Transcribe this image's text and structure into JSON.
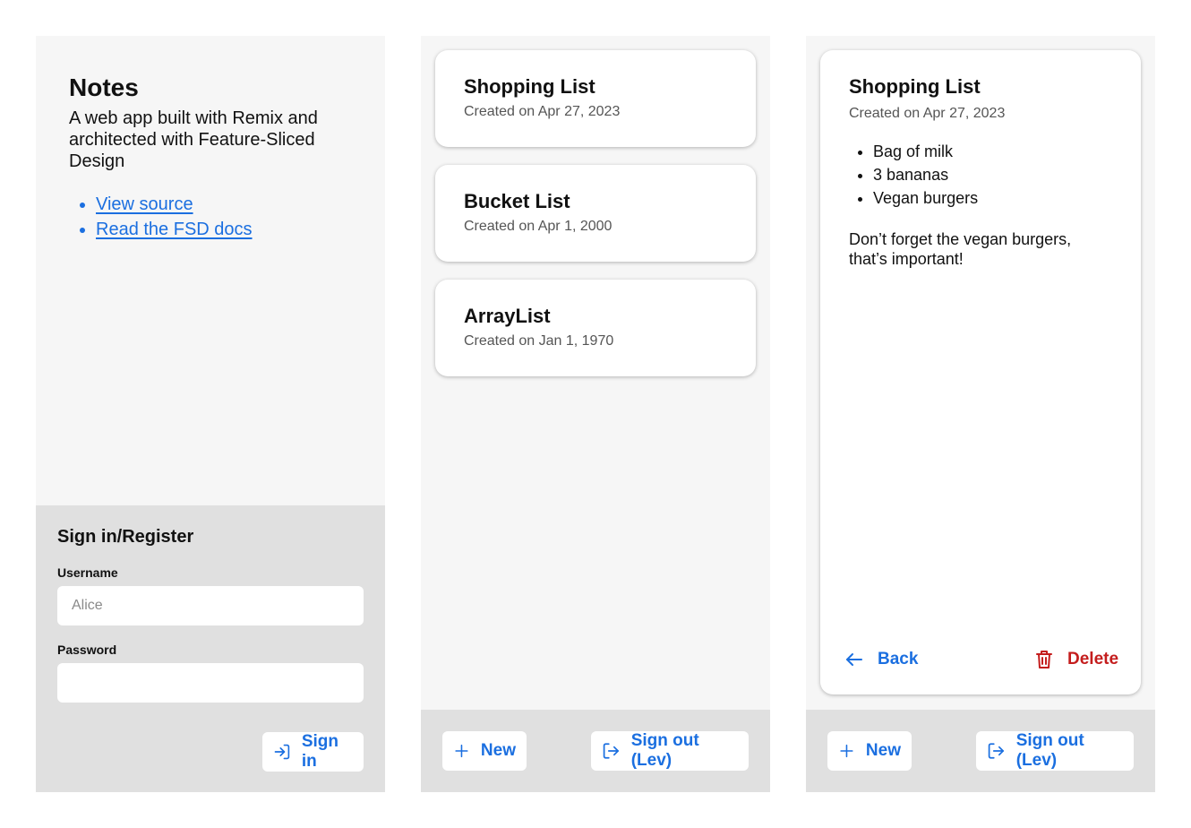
{
  "home": {
    "title": "Notes",
    "description": "A web app built with Remix and architected with Feature-Sliced Design",
    "links": [
      "View source",
      "Read the FSD docs"
    ],
    "signin": {
      "heading": "Sign in/Register",
      "username_label": "Username",
      "username_placeholder": "Alice",
      "password_label": "Password",
      "password_value": "",
      "button": "Sign in"
    }
  },
  "list": {
    "notes": [
      {
        "title": "Shopping List",
        "date": "Created on Apr 27, 2023"
      },
      {
        "title": "Bucket List",
        "date": "Created on Apr 1, 2000"
      },
      {
        "title": "ArrayList",
        "date": "Created on Jan 1, 1970"
      }
    ],
    "footer": {
      "new": "New",
      "signout": "Sign out (Lev)"
    }
  },
  "detail": {
    "title": "Shopping List",
    "date": "Created on Apr 27, 2023",
    "items": [
      "Bag of milk",
      "3 bananas",
      "Vegan burgers"
    ],
    "note": "Don’t forget the vegan burgers, that’s important!",
    "back": "Back",
    "delete": "Delete",
    "footer": {
      "new": "New",
      "signout": "Sign out (Lev)"
    }
  },
  "colors": {
    "accent": "#1b6fe0",
    "danger": "#c41d1d",
    "panel": "#f6f6f6",
    "footer": "#e0e0e0"
  }
}
